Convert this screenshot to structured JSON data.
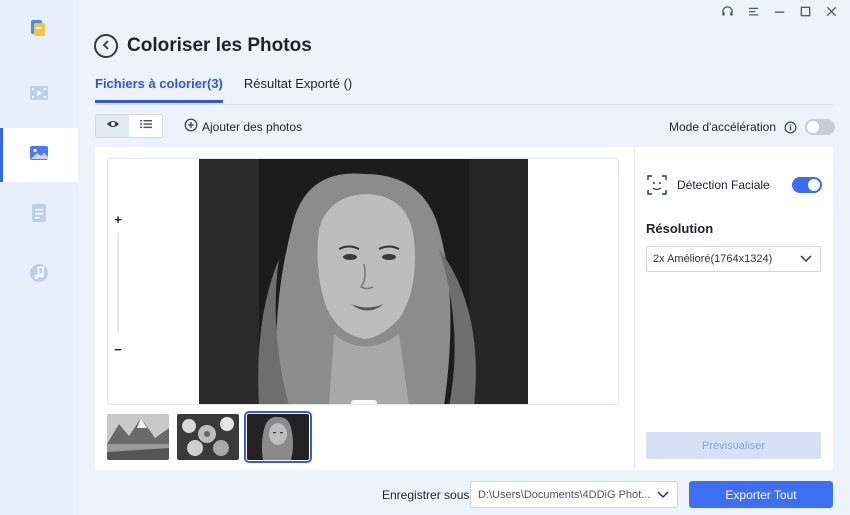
{
  "window": {
    "controls": [
      "headset-icon",
      "menu-icon",
      "minimize-icon",
      "maximize-icon",
      "close-icon"
    ]
  },
  "sidebar": {
    "logo": "app-logo-icon",
    "items": [
      {
        "icon": "video-icon",
        "active": false
      },
      {
        "icon": "photo-icon",
        "active": true
      },
      {
        "icon": "document-icon",
        "active": false
      },
      {
        "icon": "music-icon",
        "active": false
      }
    ]
  },
  "header": {
    "title": "Coloriser les Photos"
  },
  "tabs": [
    {
      "label": "Fichiers à colorier(3)",
      "active": true
    },
    {
      "label": "Résultat Exporté ()",
      "active": false
    }
  ],
  "toolbar": {
    "add_photos_label": "Ajouter des photos",
    "accel_label": "Mode d'accélération",
    "accel_on": false
  },
  "viewer": {
    "zoom_in": "+",
    "zoom_out": "−"
  },
  "thumbnails": [
    {
      "subject": "mountain-lake",
      "selected": false
    },
    {
      "subject": "flowers",
      "selected": false
    },
    {
      "subject": "portrait",
      "selected": true
    }
  ],
  "settings": {
    "face_detection_label": "Détection Faciale",
    "face_detection_on": true,
    "resolution_title": "Résolution",
    "resolution_value": "2x Amélioré(1764x1324)",
    "preview_label": "Prévisualiser"
  },
  "footer": {
    "save_label": "Enregistrer sous",
    "path_value": "D:\\Users\\Documents\\4DDiG Phot...",
    "export_label": "Exporter Tout"
  },
  "colors": {
    "accent": "#3c6ff4",
    "sidebar_bg": "#e8f0fc",
    "main_bg": "#eef3fb"
  }
}
